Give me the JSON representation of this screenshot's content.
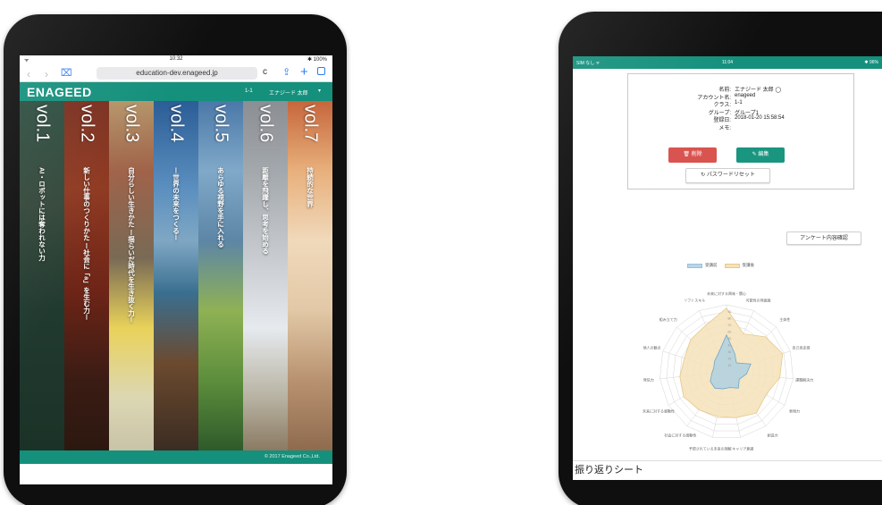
{
  "left_tablet": {
    "status": {
      "wifi": "ᯤ",
      "time": "10:32",
      "battery": "✱ 100%"
    },
    "safari": {
      "back_icon": "‹",
      "forward_icon": "›",
      "bookmarks_icon": "⌧",
      "url": "education-dev.enageed.jp",
      "reload_icon": "c",
      "share_icon": "⇪",
      "new_tab_icon": "+"
    },
    "header": {
      "logo": "ENAGEED",
      "class": "1-1",
      "user": "エナジード 太郎",
      "caret": "▾"
    },
    "volumes": [
      {
        "vol": "vol.1",
        "subtitle": "AI・ロボットには奪われない力"
      },
      {
        "vol": "vol.2",
        "subtitle": "新しい仕事のつくりかた ー社会に「a」を生む力ー"
      },
      {
        "vol": "vol.3",
        "subtitle": "自分らしい生きかた ー揺らいだ時代を生き抜く力ー"
      },
      {
        "vol": "vol.4",
        "subtitle": "ー世界の未来をつくるー"
      },
      {
        "vol": "vol.5",
        "subtitle": "あらゆる視野を手に入れる"
      },
      {
        "vol": "vol.6",
        "subtitle": "距離を飛躍し、思考を始める"
      },
      {
        "vol": "vol.7",
        "subtitle": "持続的な世界"
      }
    ],
    "footer": "© 2017 Enageed Co.,Ltd."
  },
  "right_tablet": {
    "status": {
      "left": "SIM なし ᯤ",
      "time": "11:04",
      "right": "✱ 96%"
    },
    "profile": [
      {
        "key": "名前:",
        "value": "エナジード 太郎 ◯"
      },
      {
        "key": "アカウント名:",
        "value": "enageed"
      },
      {
        "key": "クラス:",
        "value": "1-1"
      },
      {
        "key": "グループ:",
        "value": "グループ1"
      },
      {
        "key": "登録日:",
        "value": "2018-01-20 15:58:54"
      },
      {
        "key": "メモ:",
        "value": ""
      }
    ],
    "buttons": {
      "delete": "🗑  削除",
      "edit": "✎  編集",
      "reset": "↻  パスワードリセット",
      "survey": "アンケート内容確認"
    },
    "legend": {
      "before": "受講前",
      "after": "受講後",
      "before_color": "#b9d6ea",
      "after_color": "#f6e2b8"
    },
    "radar_axes": [
      "未来に対する興味・関心",
      "可能性の発掘度",
      "主体性",
      "自己肯定感",
      "課題解決力",
      "表現力",
      "創造力",
      "キャリア意識",
      "予想されている未来の理解",
      "社会に対する感動性",
      "未来に対する感動性",
      "発信力",
      "他人の観点",
      "組み立て力",
      "ソフトスキル"
    ],
    "radar_ticks": [
      "90",
      "80",
      "70",
      "60",
      "50",
      "40",
      "30",
      "20",
      "10"
    ],
    "sheet_title": "振り返りシート"
  }
}
